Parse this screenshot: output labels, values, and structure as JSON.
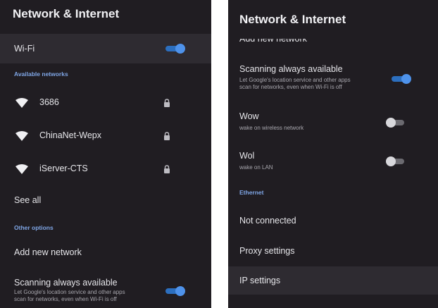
{
  "left": {
    "title": "Network & Internet",
    "wifi": {
      "label": "Wi-Fi",
      "enabled": true
    },
    "available_header": "Available networks",
    "networks": [
      {
        "name": "3686",
        "icon": "wifi-icon",
        "secured": true
      },
      {
        "name": "ChinaNet-Wepx",
        "icon": "wifi-icon",
        "secured": true
      },
      {
        "name": "iServer-CTS",
        "icon": "wifi-icon",
        "secured": true
      }
    ],
    "see_all": "See all",
    "other_header": "Other options",
    "add_network": "Add new network",
    "scanning": {
      "label": "Scanning always available",
      "desc1": "Let Google's location service and other apps",
      "desc2": "scan for networks, even when Wi-Fi is off",
      "enabled": true
    }
  },
  "right": {
    "title": "Network & Internet",
    "add_network_partial": "Add new network",
    "scanning": {
      "label": "Scanning always available",
      "desc1": "Let Google's location service and other apps",
      "desc2": "scan for networks, even when Wi-Fi is off",
      "enabled": true
    },
    "wow": {
      "label": "Wow",
      "desc": "wake on wireless network",
      "enabled": false
    },
    "wol": {
      "label": "Wol",
      "desc": "wake on LAN",
      "enabled": false
    },
    "ethernet_header": "Ethernet",
    "not_connected": "Not connected",
    "proxy": "Proxy settings",
    "ip": "IP settings"
  },
  "colors": {
    "panel_bg": "#201d22",
    "highlight_row": "#2e2b31",
    "accent_blue": "#4e92ea",
    "section_blue": "#7fa6e6"
  }
}
